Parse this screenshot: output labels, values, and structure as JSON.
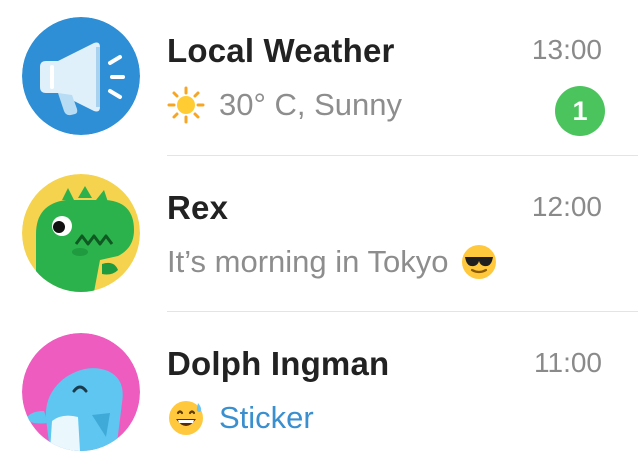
{
  "chats": [
    {
      "name": "Local Weather",
      "time": "13:00",
      "preview": "30° C, Sunny",
      "preview_icon": "sun-emoji",
      "unread_count": "1",
      "avatar_icon": "megaphone-icon",
      "avatar_color": "#2e8fd6"
    },
    {
      "name": "Rex",
      "time": "12:00",
      "preview": "It’s morning in Tokyo",
      "preview_icon": "sunglasses-emoji",
      "avatar_icon": "dinosaur-icon",
      "avatar_color": "#f5d34f"
    },
    {
      "name": "Dolph Ingman",
      "time": "11:00",
      "preview": "Sticker",
      "preview_icon": "grinning-sweat-emoji",
      "avatar_icon": "dolphin-icon",
      "avatar_color": "#ee5cc0"
    }
  ],
  "colors": {
    "badge": "#4cc45e",
    "sticker_text": "#3a8fcf",
    "name_text": "#222222",
    "preview_text": "#8d8d8d"
  }
}
